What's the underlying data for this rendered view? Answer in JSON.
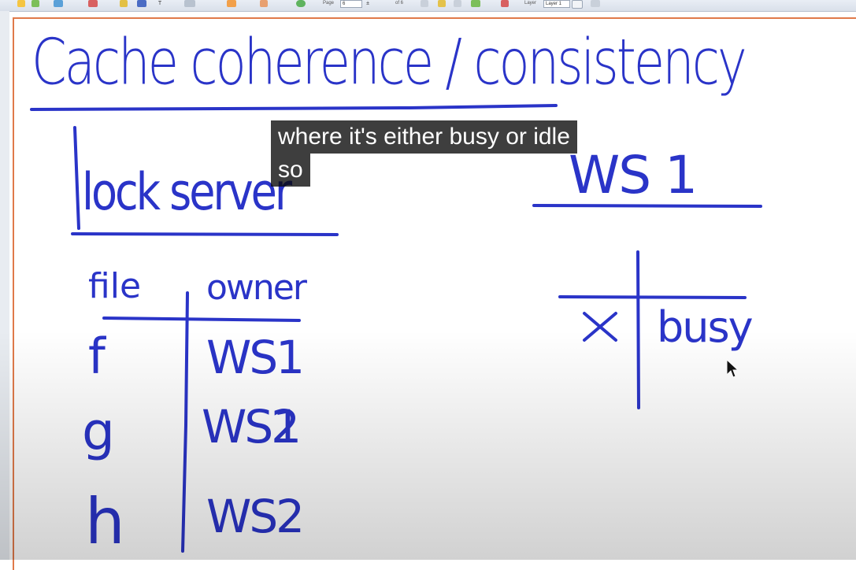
{
  "toolbar": {
    "page_label": "Page",
    "page_value": "6",
    "page_of": "of 6",
    "layer_label": "Layer",
    "layer_value": "Layer 1"
  },
  "whiteboard": {
    "title": "Cache coherence / consistency",
    "lock_server_heading": "lock server",
    "table": {
      "columns": [
        "file",
        "owner"
      ],
      "rows": [
        {
          "file": "f",
          "owner": "WS1"
        },
        {
          "file": "g",
          "owner": "WS2 (1 written over 2)"
        },
        {
          "file": "h",
          "owner": "WS2"
        }
      ]
    },
    "ws_heading": "WS 1",
    "ws_table": [
      {
        "file": "x",
        "state": "busy"
      }
    ]
  },
  "caption": {
    "line1": "where it's either busy or idle",
    "line2": "so"
  },
  "colors": {
    "ink": "#2a34c8",
    "caption_bg": "#080808",
    "page_border": "#e07a4a"
  }
}
